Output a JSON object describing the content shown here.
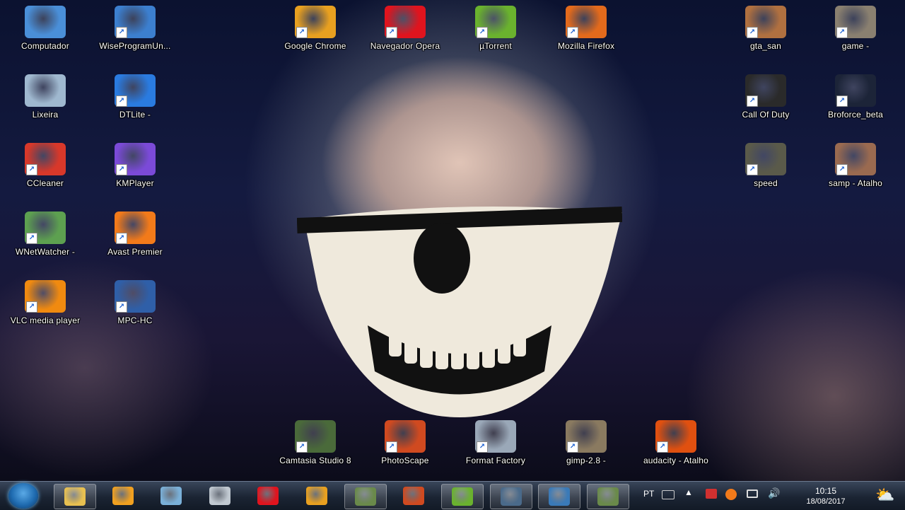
{
  "desktop": {
    "icons_left": [
      {
        "label": "Computador",
        "glyph": "monitor-icon",
        "color": "#4a8fd8",
        "shortcut": false
      },
      {
        "label": "WiseProgramUn...",
        "glyph": "wise-uninstaller-icon",
        "color": "#3c7fcf",
        "shortcut": true
      },
      {
        "label": "Lixeira",
        "glyph": "recycle-bin-icon",
        "color": "#9fb8cf",
        "shortcut": false
      },
      {
        "label": "DTLite -",
        "glyph": "daemon-tools-icon",
        "color": "#2a7be0",
        "shortcut": true
      },
      {
        "label": "CCleaner",
        "glyph": "ccleaner-icon",
        "color": "#d8382a",
        "shortcut": true
      },
      {
        "label": "KMPlayer",
        "glyph": "kmplayer-icon",
        "color": "#7b4ad8",
        "shortcut": true
      },
      {
        "label": "WNetWatcher -",
        "glyph": "eye-icon",
        "color": "#5da050",
        "shortcut": true
      },
      {
        "label": "Avast Premier",
        "glyph": "avast-icon",
        "color": "#f27a1a",
        "shortcut": true
      },
      {
        "label": "VLC media player",
        "glyph": "vlc-cone-icon",
        "color": "#f08a10",
        "shortcut": true
      },
      {
        "label": "MPC-HC",
        "glyph": "mpc-hc-icon",
        "color": "#2f5fa8",
        "shortcut": true
      }
    ],
    "icons_top": [
      {
        "label": "Google Chrome",
        "glyph": "chrome-icon",
        "color": "#e8a020",
        "shortcut": true
      },
      {
        "label": "Navegador Opera",
        "glyph": "opera-icon",
        "color": "#e0141e",
        "shortcut": true
      },
      {
        "label": "µTorrent",
        "glyph": "utorrent-icon",
        "color": "#6ab22e",
        "shortcut": true
      },
      {
        "label": "Mozilla Firefox",
        "glyph": "firefox-icon",
        "color": "#e36a1c",
        "shortcut": true
      }
    ],
    "icons_right": [
      {
        "label": "gta_san",
        "glyph": "gta-icon",
        "color": "#b07040",
        "shortcut": true
      },
      {
        "label": "game -",
        "glyph": "game-icon",
        "color": "#8a8070",
        "shortcut": true
      },
      {
        "label": "Call Of Duty",
        "glyph": "star-icon",
        "color": "#2a2a2a",
        "shortcut": true
      },
      {
        "label": "Broforce_beta",
        "glyph": "broforce-icon",
        "color": "#1c2438",
        "shortcut": true
      },
      {
        "label": "speed",
        "glyph": "nfs-icon",
        "color": "#5a5a4a",
        "shortcut": true
      },
      {
        "label": "samp - Atalho",
        "glyph": "samp-icon",
        "color": "#9a6a50",
        "shortcut": true
      }
    ],
    "icons_bottom": [
      {
        "label": "Camtasia Studio 8",
        "glyph": "camtasia-icon",
        "color": "#4a6a3a",
        "shortcut": true
      },
      {
        "label": "PhotoScape",
        "glyph": "photoscape-icon",
        "color": "#d04a20",
        "shortcut": true
      },
      {
        "label": "Format Factory",
        "glyph": "format-factory-icon",
        "color": "#9aa8b8",
        "shortcut": true
      },
      {
        "label": "gimp-2.8 -",
        "glyph": "gimp-icon",
        "color": "#8a7a60",
        "shortcut": true
      },
      {
        "label": "audacity - Atalho",
        "glyph": "audacity-icon",
        "color": "#e05010",
        "shortcut": true
      }
    ]
  },
  "taskbar": {
    "buttons": [
      {
        "name": "windows-explorer-icon",
        "color": "#e8c050",
        "active": true
      },
      {
        "name": "media-player-icon",
        "color": "#f0a020",
        "active": false
      },
      {
        "name": "notepad-icon",
        "color": "#7ab0d8",
        "active": false
      },
      {
        "name": "scanner-icon",
        "color": "#c0c8d0",
        "active": false
      },
      {
        "name": "opera-icon",
        "color": "#e0141e",
        "active": false
      },
      {
        "name": "chrome-icon",
        "color": "#e8a020",
        "active": false
      },
      {
        "name": "camtasia-icon",
        "color": "#6a8a4a",
        "active": true
      },
      {
        "name": "photoscape-icon",
        "color": "#d04a20",
        "active": false
      },
      {
        "name": "utorrent-icon",
        "color": "#6ab22e",
        "active": true
      },
      {
        "name": "terminal-icon",
        "color": "#4a6a8a",
        "active": true
      },
      {
        "name": "image-viewer-icon",
        "color": "#3a7ab8",
        "active": true
      },
      {
        "name": "camtasia-recorder-icon",
        "color": "#6a8a4a",
        "active": true
      }
    ],
    "tray": {
      "language": "PT",
      "time": "10:15",
      "date": "18/08/2017"
    }
  }
}
